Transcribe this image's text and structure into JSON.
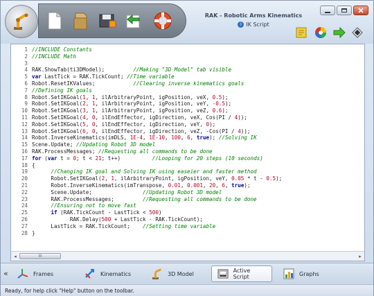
{
  "window": {
    "title": "RAK - Robotic Arms Kinematics",
    "subtitle": "IK Script"
  },
  "editor": {
    "lines": [
      {
        "n": "1",
        "segs": [
          {
            "t": "//INCLUDE Constants",
            "c": "cm"
          }
        ]
      },
      {
        "n": "2",
        "segs": [
          {
            "t": "//INCLUDE Math",
            "c": "cm"
          }
        ]
      },
      {
        "n": "3",
        "segs": []
      },
      {
        "n": "4",
        "segs": [
          {
            "t": "RAK.ShowTab(ti3DModel);         ",
            "c": "tx"
          },
          {
            "t": "//Making \"3D Model\" tab visible",
            "c": "cm"
          }
        ]
      },
      {
        "n": "5",
        "segs": [
          {
            "t": "var",
            "c": "kw"
          },
          {
            "t": " LastTick = RAK.TickCount; ",
            "c": "tx"
          },
          {
            "t": "//Time variable",
            "c": "cm"
          }
        ]
      },
      {
        "n": "6",
        "segs": [
          {
            "t": "Robot.ResetIKValues;            ",
            "c": "tx"
          },
          {
            "t": "//Clearing inverse kinematics goals",
            "c": "cm"
          }
        ]
      },
      {
        "n": "7",
        "segs": [
          {
            "t": "//Defining IK goals",
            "c": "cm"
          }
        ]
      },
      {
        "n": "8",
        "segs": [
          {
            "t": "Robot.SetIKGoal(",
            "c": "tx"
          },
          {
            "t": "1",
            "c": "num"
          },
          {
            "t": ", ",
            "c": "tx"
          },
          {
            "t": "1",
            "c": "num"
          },
          {
            "t": ", ilArbitraryPoint, igPosition, veX, ",
            "c": "tx"
          },
          {
            "t": "0.5",
            "c": "num"
          },
          {
            "t": ");",
            "c": "tx"
          }
        ]
      },
      {
        "n": "9",
        "segs": [
          {
            "t": "Robot.SetIKGoal(",
            "c": "tx"
          },
          {
            "t": "2",
            "c": "num"
          },
          {
            "t": ", ",
            "c": "tx"
          },
          {
            "t": "1",
            "c": "num"
          },
          {
            "t": ", ilArbitraryPoint, igPosition, veY, ",
            "c": "tx"
          },
          {
            "t": "-0.5",
            "c": "num"
          },
          {
            "t": ");",
            "c": "tx"
          }
        ]
      },
      {
        "n": "10",
        "segs": [
          {
            "t": "Robot.SetIKGoal(",
            "c": "tx"
          },
          {
            "t": "3",
            "c": "num"
          },
          {
            "t": ", ",
            "c": "tx"
          },
          {
            "t": "1",
            "c": "num"
          },
          {
            "t": ", ilArbitraryPoint, igPosition, veZ, ",
            "c": "tx"
          },
          {
            "t": "0.6",
            "c": "num"
          },
          {
            "t": ");",
            "c": "tx"
          }
        ]
      },
      {
        "n": "11",
        "segs": [
          {
            "t": "Robot.SetIKGoal(",
            "c": "tx"
          },
          {
            "t": "4",
            "c": "num"
          },
          {
            "t": ", ",
            "c": "tx"
          },
          {
            "t": "0",
            "c": "num"
          },
          {
            "t": ", ilEndEffector, igDirection, veX, Cos(PI / ",
            "c": "tx"
          },
          {
            "t": "4",
            "c": "num"
          },
          {
            "t": "));",
            "c": "tx"
          }
        ]
      },
      {
        "n": "12",
        "segs": [
          {
            "t": "Robot.SetIKGoal(",
            "c": "tx"
          },
          {
            "t": "5",
            "c": "num"
          },
          {
            "t": ", ",
            "c": "tx"
          },
          {
            "t": "0",
            "c": "num"
          },
          {
            "t": ", ilEndEffector, igDirection, veY, ",
            "c": "tx"
          },
          {
            "t": "0",
            "c": "num"
          },
          {
            "t": ");",
            "c": "tx"
          }
        ]
      },
      {
        "n": "13",
        "segs": [
          {
            "t": "Robot.SetIKGoal(",
            "c": "tx"
          },
          {
            "t": "6",
            "c": "num"
          },
          {
            "t": ", ",
            "c": "tx"
          },
          {
            "t": "0",
            "c": "num"
          },
          {
            "t": ", ilEndEffector, igDirection, veZ, -Cos(PI / ",
            "c": "tx"
          },
          {
            "t": "4",
            "c": "num"
          },
          {
            "t": "));",
            "c": "tx"
          }
        ]
      },
      {
        "n": "14",
        "segs": [
          {
            "t": "Robot.InverseKinematics(imDLS, ",
            "c": "tx"
          },
          {
            "t": "1E-4",
            "c": "num"
          },
          {
            "t": ", ",
            "c": "tx"
          },
          {
            "t": "1E-10",
            "c": "num"
          },
          {
            "t": ", ",
            "c": "tx"
          },
          {
            "t": "100",
            "c": "num"
          },
          {
            "t": ", ",
            "c": "tx"
          },
          {
            "t": "6",
            "c": "num"
          },
          {
            "t": ", ",
            "c": "tx"
          },
          {
            "t": "true",
            "c": "kw"
          },
          {
            "t": "); ",
            "c": "tx"
          },
          {
            "t": "//Solving IK",
            "c": "cm"
          }
        ]
      },
      {
        "n": "15",
        "segs": [
          {
            "t": "Scene.Update; ",
            "c": "tx"
          },
          {
            "t": "//Updating Robot 3D model",
            "c": "cm"
          }
        ]
      },
      {
        "n": "16",
        "segs": [
          {
            "t": "RAK.ProcessMessages; ",
            "c": "tx"
          },
          {
            "t": "//Requesting all commands to be done",
            "c": "cm"
          }
        ]
      },
      {
        "n": "17",
        "segs": [
          {
            "t": "for",
            "c": "kw"
          },
          {
            "t": " (",
            "c": "tx"
          },
          {
            "t": "var",
            "c": "kw"
          },
          {
            "t": " t = ",
            "c": "tx"
          },
          {
            "t": "0",
            "c": "num"
          },
          {
            "t": "; t < ",
            "c": "tx"
          },
          {
            "t": "21",
            "c": "num"
          },
          {
            "t": "; t++)          ",
            "c": "tx"
          },
          {
            "t": "//Looping for 20 steps (10 seconds)",
            "c": "cm"
          }
        ]
      },
      {
        "n": "18",
        "segs": [
          {
            "t": "{",
            "c": "tx"
          }
        ]
      },
      {
        "n": "19",
        "segs": [
          {
            "t": "      ",
            "c": "tx"
          },
          {
            "t": "//Changing IK goal and Solving IK using easeier and faster method",
            "c": "cm"
          }
        ]
      },
      {
        "n": "20",
        "segs": [
          {
            "t": "      Robot.SetIKGoal(",
            "c": "tx"
          },
          {
            "t": "2",
            "c": "num"
          },
          {
            "t": ", ",
            "c": "tx"
          },
          {
            "t": "1",
            "c": "num"
          },
          {
            "t": ", ilArbitraryPoint, igPosition, veY, ",
            "c": "tx"
          },
          {
            "t": "0.05",
            "c": "num"
          },
          {
            "t": " * t - ",
            "c": "tx"
          },
          {
            "t": "0.5",
            "c": "num"
          },
          {
            "t": ");",
            "c": "tx"
          }
        ]
      },
      {
        "n": "21",
        "segs": [
          {
            "t": "      Robot.InverseKinematics(imTranspose, ",
            "c": "tx"
          },
          {
            "t": "0.01",
            "c": "num"
          },
          {
            "t": ", ",
            "c": "tx"
          },
          {
            "t": "0.001",
            "c": "num"
          },
          {
            "t": ", ",
            "c": "tx"
          },
          {
            "t": "20",
            "c": "num"
          },
          {
            "t": ", ",
            "c": "tx"
          },
          {
            "t": "6",
            "c": "num"
          },
          {
            "t": ", ",
            "c": "tx"
          },
          {
            "t": "true",
            "c": "kw"
          },
          {
            "t": ");",
            "c": "tx"
          }
        ]
      },
      {
        "n": "22",
        "segs": [
          {
            "t": "      Scene.Update;                ",
            "c": "tx"
          },
          {
            "t": "//Updating Robot 3D model",
            "c": "cm"
          }
        ]
      },
      {
        "n": "23",
        "segs": [
          {
            "t": "      RAK.ProcessMessages;         ",
            "c": "tx"
          },
          {
            "t": "//Requesting all commands to be done",
            "c": "cm"
          }
        ]
      },
      {
        "n": "24",
        "segs": [
          {
            "t": "      ",
            "c": "tx"
          },
          {
            "t": "//Ensuring not to move fast",
            "c": "cm"
          }
        ]
      },
      {
        "n": "25",
        "segs": [
          {
            "t": "      ",
            "c": "tx"
          },
          {
            "t": "if",
            "c": "kw"
          },
          {
            "t": " (RAK.TickCount - LastTick < ",
            "c": "tx"
          },
          {
            "t": "500",
            "c": "num"
          },
          {
            "t": ")",
            "c": "tx"
          }
        ]
      },
      {
        "n": "26",
        "segs": [
          {
            "t": "            RAK.Delay(",
            "c": "tx"
          },
          {
            "t": "500",
            "c": "num"
          },
          {
            "t": " + LastTick - RAK.TickCount);",
            "c": "tx"
          }
        ]
      },
      {
        "n": "27",
        "segs": [
          {
            "t": "      LastTick = RAK.TickCount;    ",
            "c": "tx"
          },
          {
            "t": "//Setting time variable",
            "c": "cm"
          }
        ]
      },
      {
        "n": "28",
        "segs": [
          {
            "t": "}",
            "c": "tx"
          }
        ]
      }
    ],
    "scroll_label": "III"
  },
  "tabs": {
    "scroll_arrow": "«",
    "items": [
      {
        "label": "Frames",
        "icon": "frames-axes-icon"
      },
      {
        "label": "Kinematics",
        "icon": "kinematics-arrows-icon"
      },
      {
        "label": "3D Model",
        "icon": "robot-arm-icon"
      },
      {
        "label": "Active Script",
        "icon": "script-document-icon"
      },
      {
        "label": "Graphs",
        "icon": "graph-chart-icon"
      }
    ]
  },
  "status": {
    "text": "Ready, for help click \"Help\" button on the toolbar."
  },
  "colors": {
    "comment": "#008000",
    "keyword": "#00008b",
    "number": "#b8001f"
  }
}
